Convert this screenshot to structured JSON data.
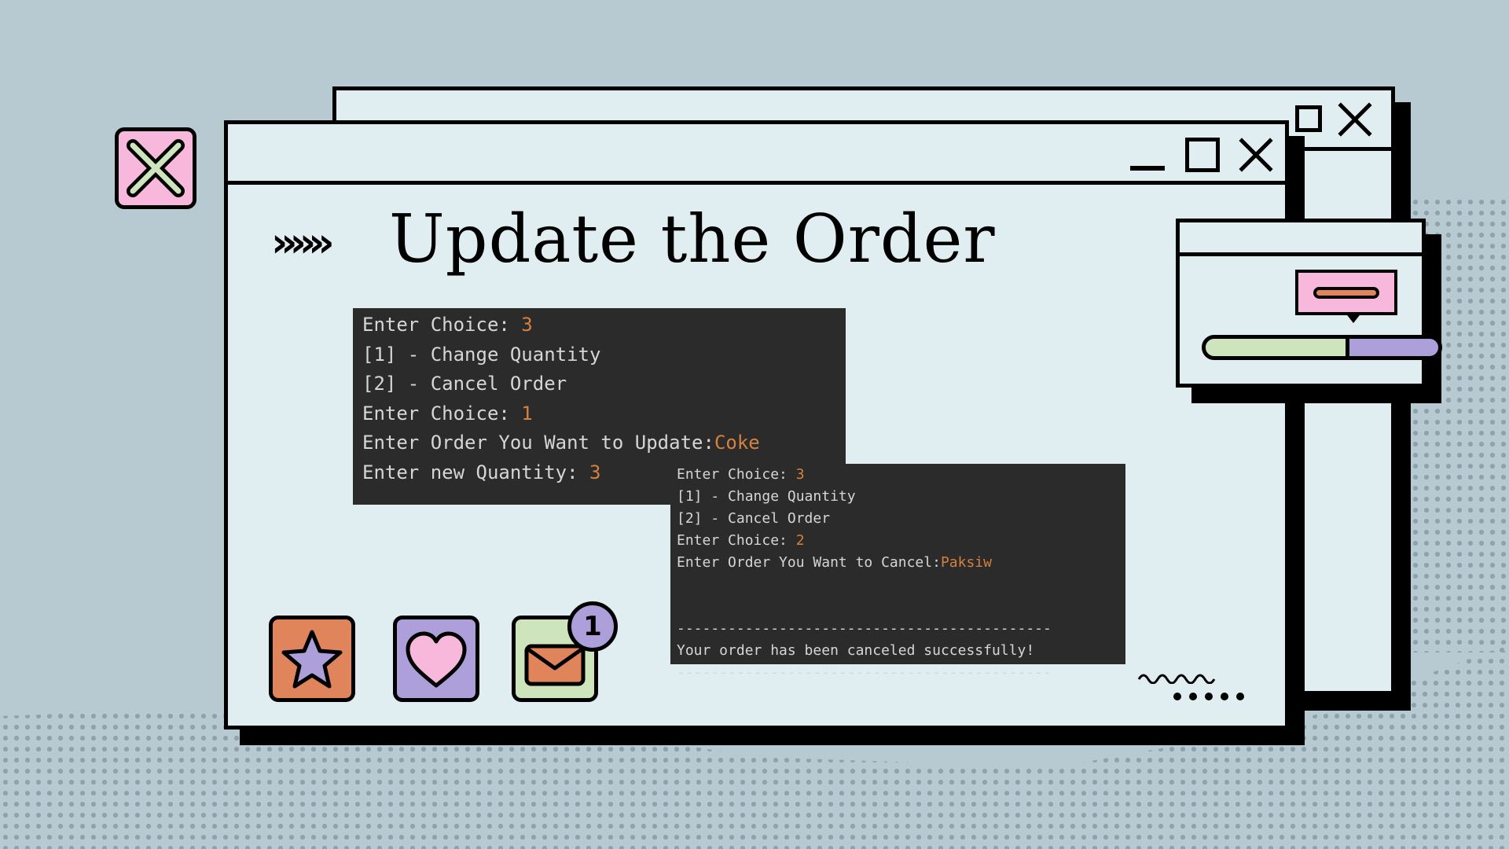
{
  "title": "Update the Order",
  "arrows": "»»»",
  "console_1": {
    "lines": [
      {
        "text": "Enter Choice: ",
        "value": "3"
      },
      {
        "text": "[1] - Change Quantity",
        "value": ""
      },
      {
        "text": "[2] - Cancel Order",
        "value": ""
      },
      {
        "text": "Enter Choice: ",
        "value": "1"
      },
      {
        "text": "Enter Order You Want to Update:",
        "value": "Coke"
      },
      {
        "text": "Enter new Quantity: ",
        "value": "3"
      }
    ]
  },
  "console_2": {
    "lines": [
      {
        "text": "Enter Choice: ",
        "value": "3"
      },
      {
        "text": "[1] - Change Quantity",
        "value": ""
      },
      {
        "text": "[2] - Cancel Order",
        "value": ""
      },
      {
        "text": "Enter Choice: ",
        "value": "2"
      },
      {
        "text": "Enter Order You Want to Cancel:",
        "value": "Paksiw"
      },
      {
        "text": "",
        "value": ""
      },
      {
        "text": "",
        "value": ""
      },
      {
        "text": "--------------------------------------------",
        "value": ""
      },
      {
        "text": "Your order has been canceled successfully!",
        "value": ""
      },
      {
        "text": "--------------------------------------------",
        "value": ""
      }
    ]
  },
  "icons": {
    "star": "star-icon",
    "heart": "heart-icon",
    "mail": "mail-icon",
    "mail_badge": "1"
  },
  "progress": {
    "value": 0.6
  },
  "colors": {
    "background": "#b7c9d1",
    "window": "#e0edf1",
    "console_bg": "#2b2b2b",
    "console_text": "#d6d6d6",
    "console_value": "#d5813f",
    "pink": "#f7b8dc",
    "orange": "#e0845c",
    "purple": "#ad9fd9",
    "green": "#cde4bd"
  }
}
